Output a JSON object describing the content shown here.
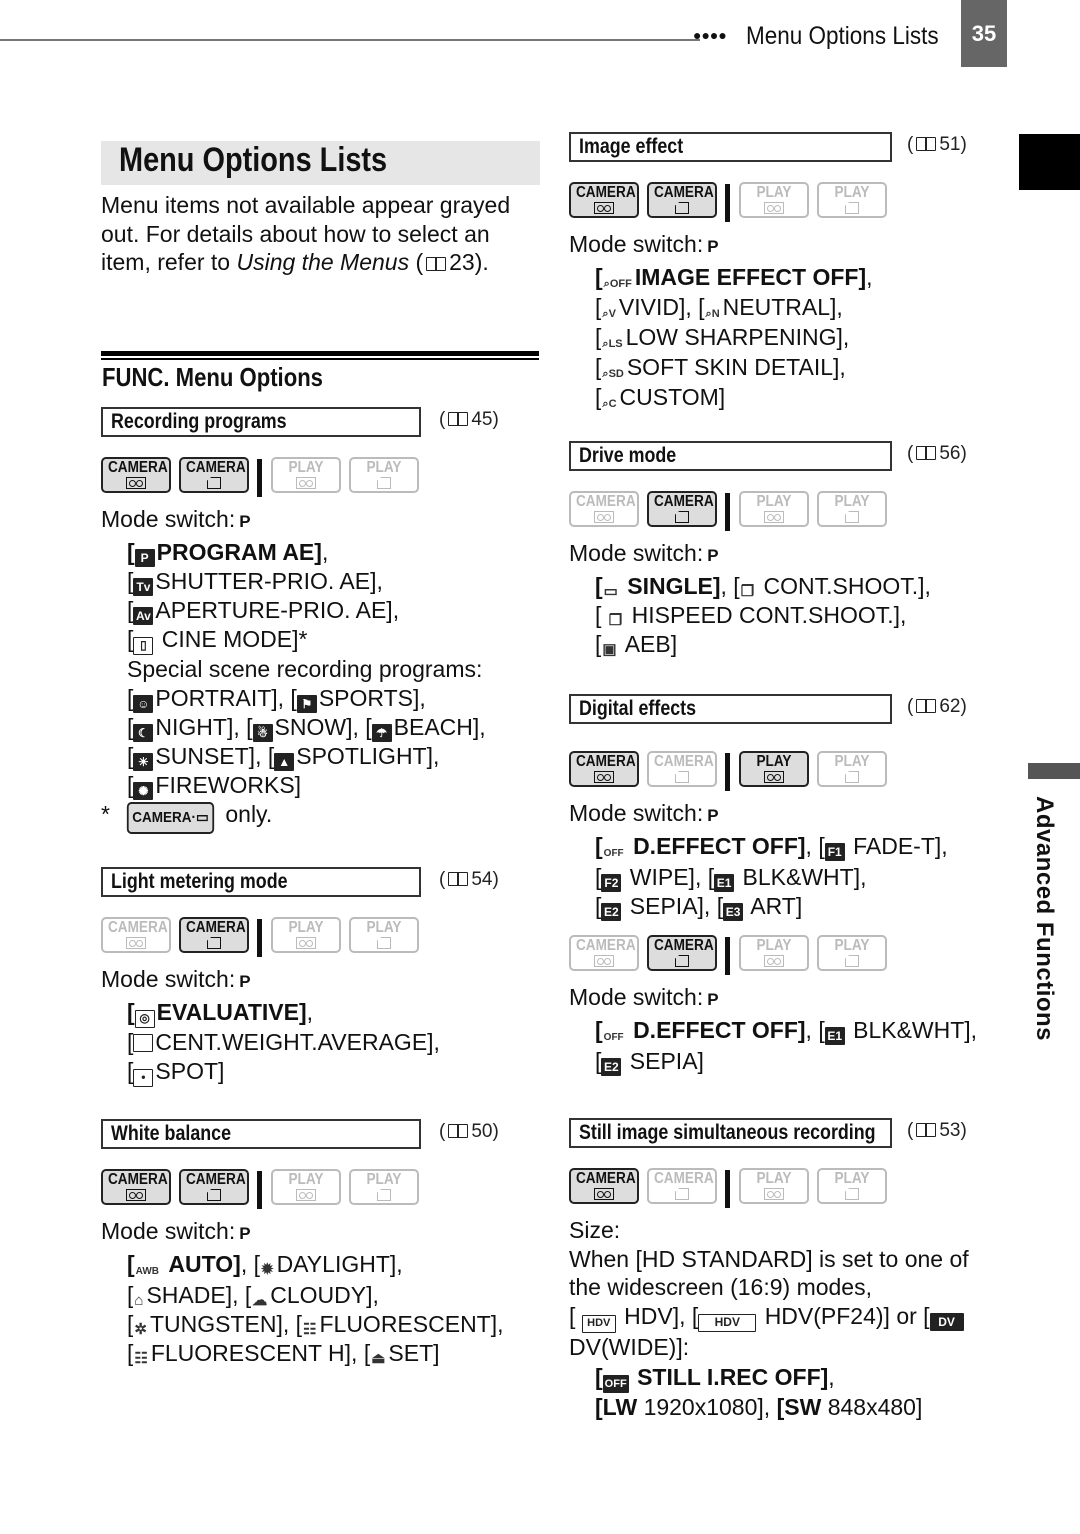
{
  "header": {
    "dots": "●●●●",
    "title": "Menu Options Lists",
    "page_number": "35"
  },
  "side_tab": {
    "label": "Advanced Functions"
  },
  "page_title": "Menu Options Lists",
  "intro": {
    "text_before": "Menu items not available appear grayed out. For details about how to select an item, refer to ",
    "italic": "Using the Menus",
    "ref_open": " (",
    "ref_page": "23",
    "ref_close": ")."
  },
  "func_heading": "FUNC. Menu Options",
  "mode_labels": {
    "camera": "CAMERA",
    "play": "PLAY"
  },
  "mode_switch_label": "Mode switch:",
  "mode_switch_value": "P",
  "sections": {
    "recording_programs": {
      "title": "Recording programs",
      "ref": "45",
      "modes": {
        "camera_tape": true,
        "camera_card": true,
        "play_tape": false,
        "play_card": false
      },
      "options": [
        {
          "icon": "P",
          "label": "PROGRAM AE]",
          "bold": true,
          "suffix": ","
        },
        {
          "icon": "Tv",
          "label": "SHUTTER-PRIO. AE],",
          "bold": false
        },
        {
          "icon": "Av",
          "label": "APERTURE-PRIO. AE],",
          "bold": false
        },
        {
          "icon": "film",
          "label": "CINE MODE]*",
          "bold": false
        }
      ],
      "special_heading": "Special scene recording programs:",
      "special_lines": [
        [
          "PORTRAIT],",
          "SPORTS],"
        ],
        [
          "NIGHT],",
          "SNOW],",
          "BEACH],"
        ],
        [
          "SUNSET],",
          "SPOTLIGHT],"
        ],
        [
          "FIREWORKS]"
        ]
      ],
      "footnote_mark": "*",
      "footnote_badge": "CAMERA·",
      "footnote_text": "only."
    },
    "light_metering": {
      "title": "Light metering mode",
      "ref": "54",
      "modes": {
        "camera_tape": false,
        "camera_card": true,
        "play_tape": false,
        "play_card": false
      },
      "options": [
        {
          "label": "EVALUATIVE]",
          "bold": true,
          "suffix": ","
        },
        {
          "label": "CENT.WEIGHT.AVERAGE],",
          "bold": false
        },
        {
          "label": "SPOT]",
          "bold": false
        }
      ]
    },
    "white_balance": {
      "title": "White balance",
      "ref": "50",
      "modes": {
        "camera_tape": true,
        "camera_card": true,
        "play_tape": false,
        "play_card": false
      },
      "lines": [
        [
          "AUTO]",
          "DAYLIGHT],"
        ],
        [
          "SHADE],",
          "CLOUDY],"
        ],
        [
          "TUNGSTEN],",
          "FLUORESCENT],"
        ],
        [
          "FLUORESCENT H],",
          "SET]"
        ]
      ],
      "awb_icon": "AWB"
    },
    "image_effect": {
      "title": "Image effect",
      "ref": "51",
      "modes": {
        "camera_tape": true,
        "camera_card": true,
        "play_tape": false,
        "play_card": false
      },
      "lines": [
        [
          "IMAGE EFFECT OFF]"
        ],
        [
          "VIVID],",
          "NEUTRAL],"
        ],
        [
          "LOW SHARPENING],"
        ],
        [
          "SOFT SKIN DETAIL],"
        ],
        [
          "CUSTOM]"
        ]
      ],
      "icon_suffixes": [
        "OFF",
        "V",
        "N",
        "LS",
        "SD",
        "C"
      ]
    },
    "drive_mode": {
      "title": "Drive mode",
      "ref": "56",
      "modes": {
        "camera_tape": false,
        "camera_card": true,
        "play_tape": false,
        "play_card": false
      },
      "lines": [
        [
          "SINGLE]",
          "CONT.SHOOT.],"
        ],
        [
          "HISPEED CONT.SHOOT.],"
        ],
        [
          "AEB]"
        ]
      ]
    },
    "digital_effects": {
      "title": "Digital effects",
      "ref": "62",
      "modes_a": {
        "camera_tape": true,
        "camera_card": false,
        "play_tape": true,
        "play_card": false
      },
      "lines_a": [
        [
          "D.EFFECT OFF]",
          "FADE-T],"
        ],
        [
          "WIPE],",
          "BLK&WHT],"
        ],
        [
          "SEPIA],",
          "ART]"
        ]
      ],
      "modes_b": {
        "camera_tape": false,
        "camera_card": true,
        "play_tape": false,
        "play_card": false
      },
      "lines_b": [
        [
          "D.EFFECT OFF]",
          "BLK&WHT],"
        ],
        [
          "SEPIA]"
        ]
      ],
      "icons": {
        "off": "OFF",
        "f1": "F1",
        "f2": "F2",
        "e1": "E1",
        "e2": "E2",
        "e3": "E3"
      }
    },
    "still_simultaneous": {
      "title": "Still image simultaneous recording",
      "ref": "53",
      "modes": {
        "camera_tape": true,
        "camera_card": false,
        "play_tape": false,
        "play_card": false
      },
      "size_label": "Size:",
      "desc": "When [HD STANDARD] is set to one of the widescreen (16:9) modes,",
      "formats": {
        "hdv": "HDV],",
        "hdv_pf24": "HDV(PF24)] or [",
        "dv_wide": "DV(WIDE)]:"
      },
      "format_icons": {
        "hdv": "HDV",
        "hdv_pf24": "HDV",
        "dv": "DV"
      },
      "opt_off": "STILL I.REC OFF]",
      "lw_icon": "LW",
      "lw_value": "1920x1080],",
      "sw_icon": "SW",
      "sw_value": "848x480]",
      "off_icon": "OFF"
    }
  }
}
